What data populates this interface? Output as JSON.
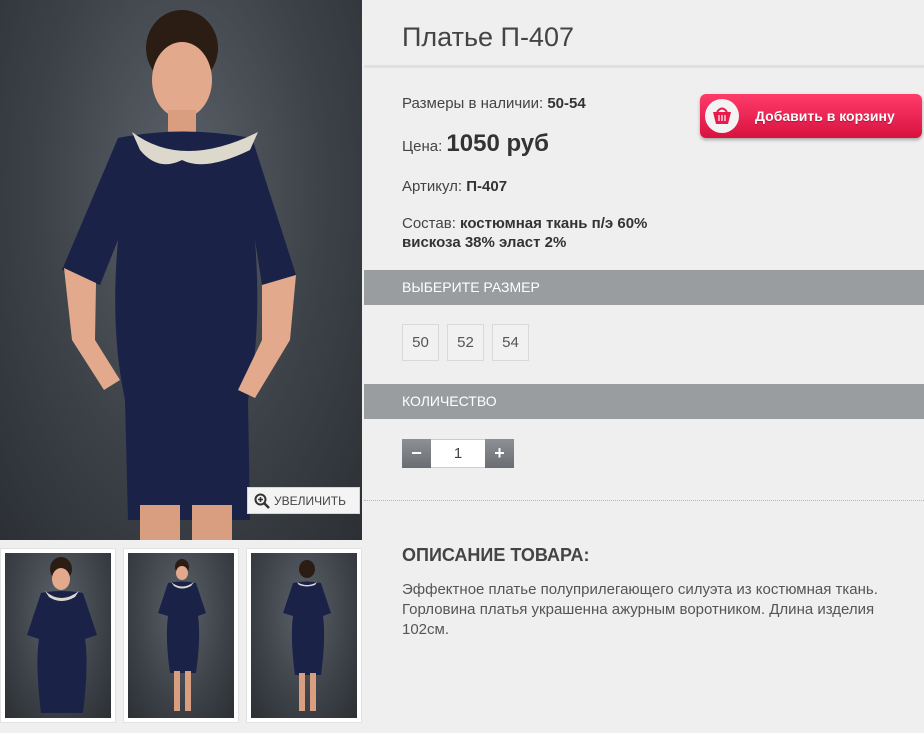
{
  "product": {
    "title": "Платье П-407",
    "sizes_label": "Размеры в наличии:",
    "sizes_value": "50-54",
    "price_label": "Цена:",
    "price_value": "1050 руб",
    "article_label": "Артикул:",
    "article_value": "П-407",
    "composition_label": "Состав:",
    "composition_line1": "костюмная ткань п/э 60%",
    "composition_line2": "вискоза 38% эласт 2%"
  },
  "cart": {
    "label": "Добавить в корзину",
    "icon": "basket-icon",
    "color": "#e81a4b"
  },
  "gallery": {
    "zoom_label": "УВЕЛИЧИТЬ",
    "zoom_icon": "magnifier-plus-icon",
    "thumb_count": 3
  },
  "size_section": {
    "title": "ВЫБЕРИТЕ РАЗМЕР",
    "options": [
      "50",
      "52",
      "54"
    ]
  },
  "quantity_section": {
    "title": "КОЛИЧЕСТВО",
    "value": "1",
    "minus": "−",
    "plus": "+"
  },
  "description": {
    "title": "ОПИСАНИЕ ТОВАРА:",
    "text": "Эффектное платье полуприлегающего силуэта из костюмная ткань. Горловина платья украшенна ажурным воротником. Длина изделия 102см."
  }
}
